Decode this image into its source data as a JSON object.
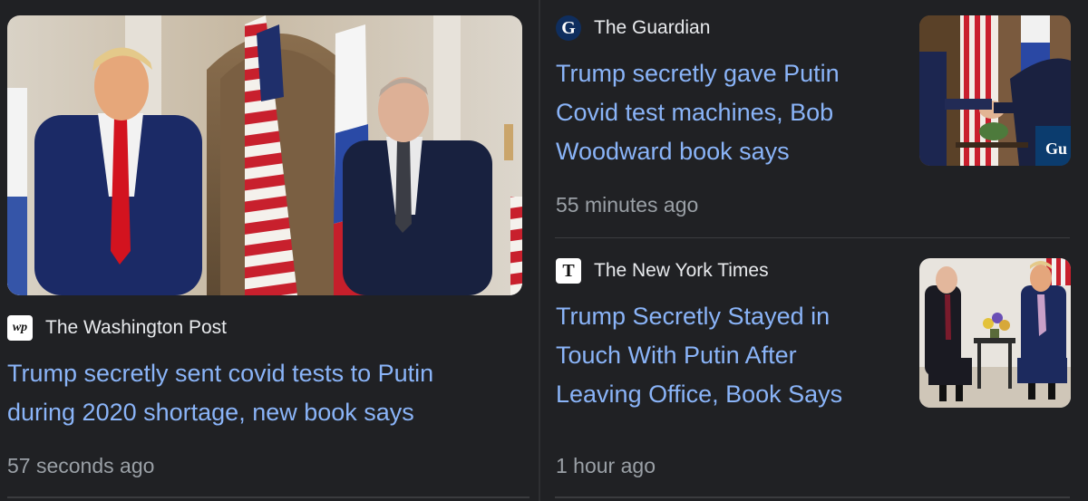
{
  "left_card": {
    "source": "The Washington Post",
    "logo_text": "wp",
    "headline_line1": "Trump secretly sent covid tests to Putin",
    "headline_line2": "during 2020 shortage, new book says",
    "time": "57 seconds ago",
    "image": "Trump and Putin standing before US and Russian flags"
  },
  "right_top_card": {
    "source": "The Guardian",
    "logo_text": "G",
    "headline_line1": "Trump secretly gave Putin",
    "headline_line2": "Covid test machines, Bob",
    "headline_line3": "Woodward book says",
    "time": "55 minutes ago",
    "thumb_overlay": "Gu",
    "image": "Trump and Putin shaking hands"
  },
  "right_bottom_card": {
    "source": "The New York Times",
    "logo_text": "T",
    "headline_line1": "Trump Secretly Stayed in",
    "headline_line2": "Touch With Putin After",
    "headline_line3": "Leaving Office, Book Says",
    "time": "1 hour ago",
    "image": "Putin and Trump seated in chairs"
  },
  "colors": {
    "background": "#202124",
    "headline": "#8ab4f8",
    "source": "#e8eaed",
    "time": "#9aa0a6"
  }
}
